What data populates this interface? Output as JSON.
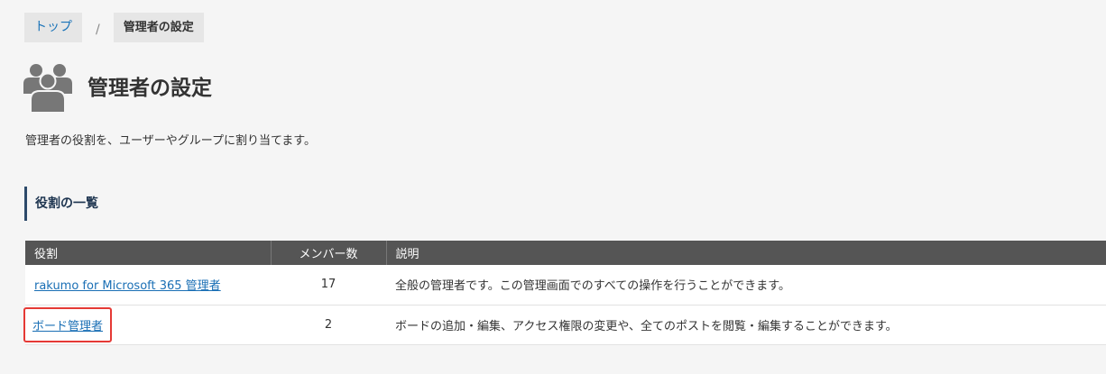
{
  "breadcrumb": {
    "home": "トップ",
    "separator": "/",
    "current": "管理者の設定"
  },
  "page": {
    "title": "管理者の設定",
    "icon": "admin-users-icon",
    "description": "管理者の役割を、ユーザーやグループに割り当てます。"
  },
  "section": {
    "title": "役割の一覧"
  },
  "table": {
    "headers": {
      "role": "役割",
      "member_count": "メンバー数",
      "description": "説明"
    },
    "rows": [
      {
        "role": "rakumo for Microsoft 365 管理者",
        "member_count": "17",
        "description": "全般の管理者です。この管理画面でのすべての操作を行うことができます。"
      },
      {
        "role": "ボード管理者",
        "member_count": "2",
        "description": "ボードの追加・編集、アクセス権限の変更や、全てのポストを閲覧・編集することができます。"
      }
    ]
  },
  "colors": {
    "link": "#1a6fb5",
    "header_bg": "#555555",
    "highlight": "#e53935",
    "section_accent": "#2d4a6a"
  }
}
